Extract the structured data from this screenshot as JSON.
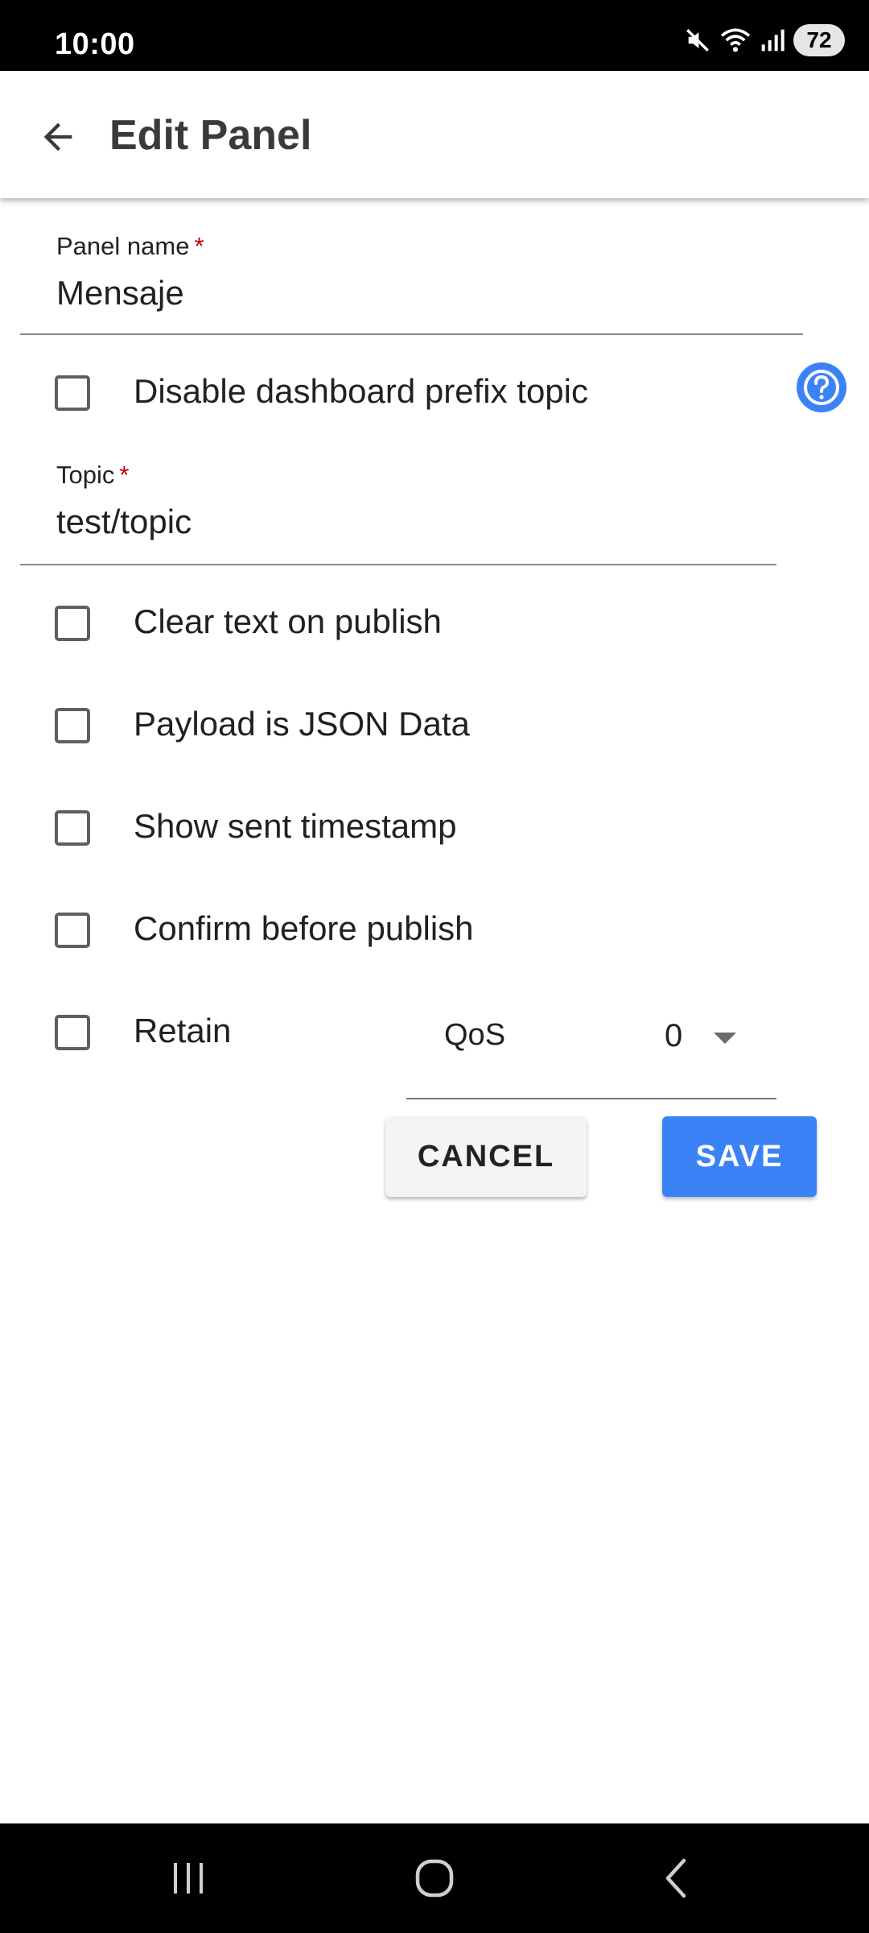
{
  "status_bar": {
    "time": "10:00",
    "battery": "72",
    "icons": [
      "mute-icon",
      "wifi-icon",
      "signal-icon",
      "battery-icon"
    ]
  },
  "app_bar": {
    "title": "Edit Panel",
    "back_icon": "arrow-back-icon"
  },
  "form": {
    "panel_name": {
      "label": "Panel name",
      "required_mark": "*",
      "value": "Mensaje"
    },
    "disable_prefix": {
      "label": "Disable dashboard prefix topic",
      "checked": false,
      "help_icon": "help-icon"
    },
    "topic": {
      "label": "Topic",
      "required_mark": "*",
      "value": "test/topic"
    },
    "options": [
      {
        "label": "Clear text on publish",
        "checked": false
      },
      {
        "label": "Payload is JSON Data",
        "checked": false
      },
      {
        "label": "Show sent timestamp",
        "checked": false
      },
      {
        "label": "Confirm before publish",
        "checked": false
      },
      {
        "label": "Retain",
        "checked": false
      }
    ],
    "qos": {
      "label": "QoS",
      "value": "0"
    }
  },
  "actions": {
    "cancel_label": "CANCEL",
    "save_label": "SAVE"
  },
  "colors": {
    "accent": "#3b82f6",
    "required": "#c00000"
  },
  "nav_bar": {
    "icons": [
      "recent-apps-icon",
      "home-icon",
      "back-icon"
    ]
  }
}
